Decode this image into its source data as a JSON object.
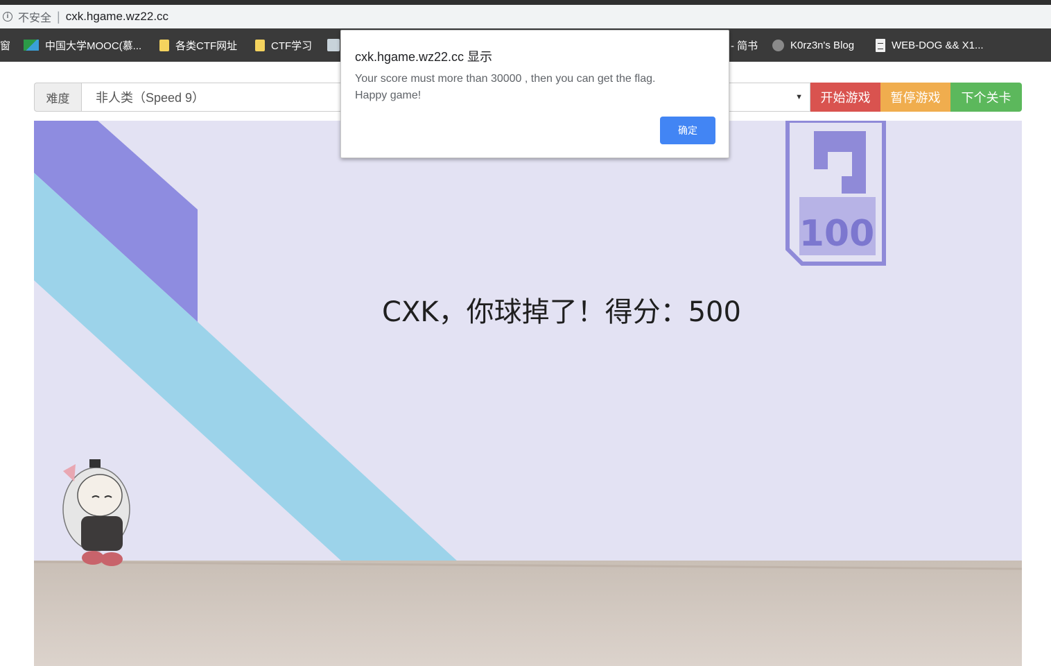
{
  "browser": {
    "security_label": "不安全",
    "separator": "|",
    "url": "cxk.hgame.wz22.cc",
    "bookmarks": [
      {
        "label": "窗",
        "icon": "none"
      },
      {
        "label": "中国大学MOOC(慕...",
        "icon": "mooc-icon"
      },
      {
        "label": "各类CTF网址",
        "icon": "folder-icon"
      },
      {
        "label": "CTF学习",
        "icon": "folder-icon"
      },
      {
        "label": "",
        "icon": "image-icon"
      },
      {
        "label": "- 简书",
        "icon": "none"
      },
      {
        "label": "K0rz3n's Blog",
        "icon": "globe-icon"
      },
      {
        "label": "WEB-DOG && X1...",
        "icon": "document-icon"
      }
    ]
  },
  "controls": {
    "difficulty_label": "难度",
    "difficulty_value": "非人类（Speed 9）",
    "start_button": "开始游戏",
    "pause_button": "暂停游戏",
    "next_button": "下个关卡"
  },
  "game": {
    "message": "CXK，你球掉了！得分：500",
    "badge_number": "100"
  },
  "dialog": {
    "title": "cxk.hgame.wz22.cc 显示",
    "message_line1": "Your score must more than 30000 , then you can get the flag.",
    "message_line2": "Happy game!",
    "ok_button": "确定"
  },
  "colors": {
    "start": "#d9534f",
    "pause": "#f0ad4e",
    "next": "#5cb85c",
    "dialog_ok": "#4285f4"
  }
}
